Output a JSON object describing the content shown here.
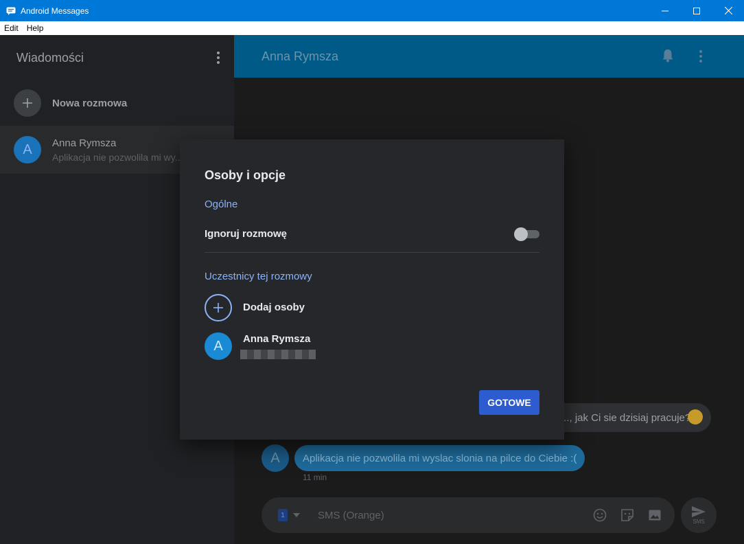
{
  "window": {
    "title": "Android Messages"
  },
  "menu": {
    "edit": "Edit",
    "help": "Help"
  },
  "sidebar": {
    "title": "Wiadomości",
    "new_conversation": "Nowa rozmowa",
    "conversations": [
      {
        "avatar_letter": "A",
        "name": "Anna Rymsza",
        "snippet": "Aplikacja nie pozwolila mi wy..."
      }
    ]
  },
  "conversation": {
    "title": "Anna Rymsza",
    "incoming_message": "..., jak Ci sie dzisiaj pracuje?",
    "outgoing_avatar_letter": "A",
    "outgoing_message": "Aplikacja nie pozwolila mi wyslac slonia na pilce do Ciebie :(",
    "outgoing_time": "11 min",
    "composer": {
      "sim_number": "1",
      "placeholder": "SMS (Orange)",
      "send_label": "SMS"
    }
  },
  "dialog": {
    "title": "Osoby i opcje",
    "general_section": "Ogólne",
    "ignore_label": "Ignoruj rozmowę",
    "ignore_enabled": false,
    "participants_section": "Uczestnicy tej rozmowy",
    "add_people": "Dodaj osoby",
    "participant": {
      "avatar_letter": "A",
      "name": "Anna Rymsza"
    },
    "done_button": "GOTOWE"
  },
  "colors": {
    "titlebar": "#0078d7",
    "header": "#005a87",
    "accent_link": "#8ab4f8",
    "primary_button": "#2d5bd0"
  }
}
